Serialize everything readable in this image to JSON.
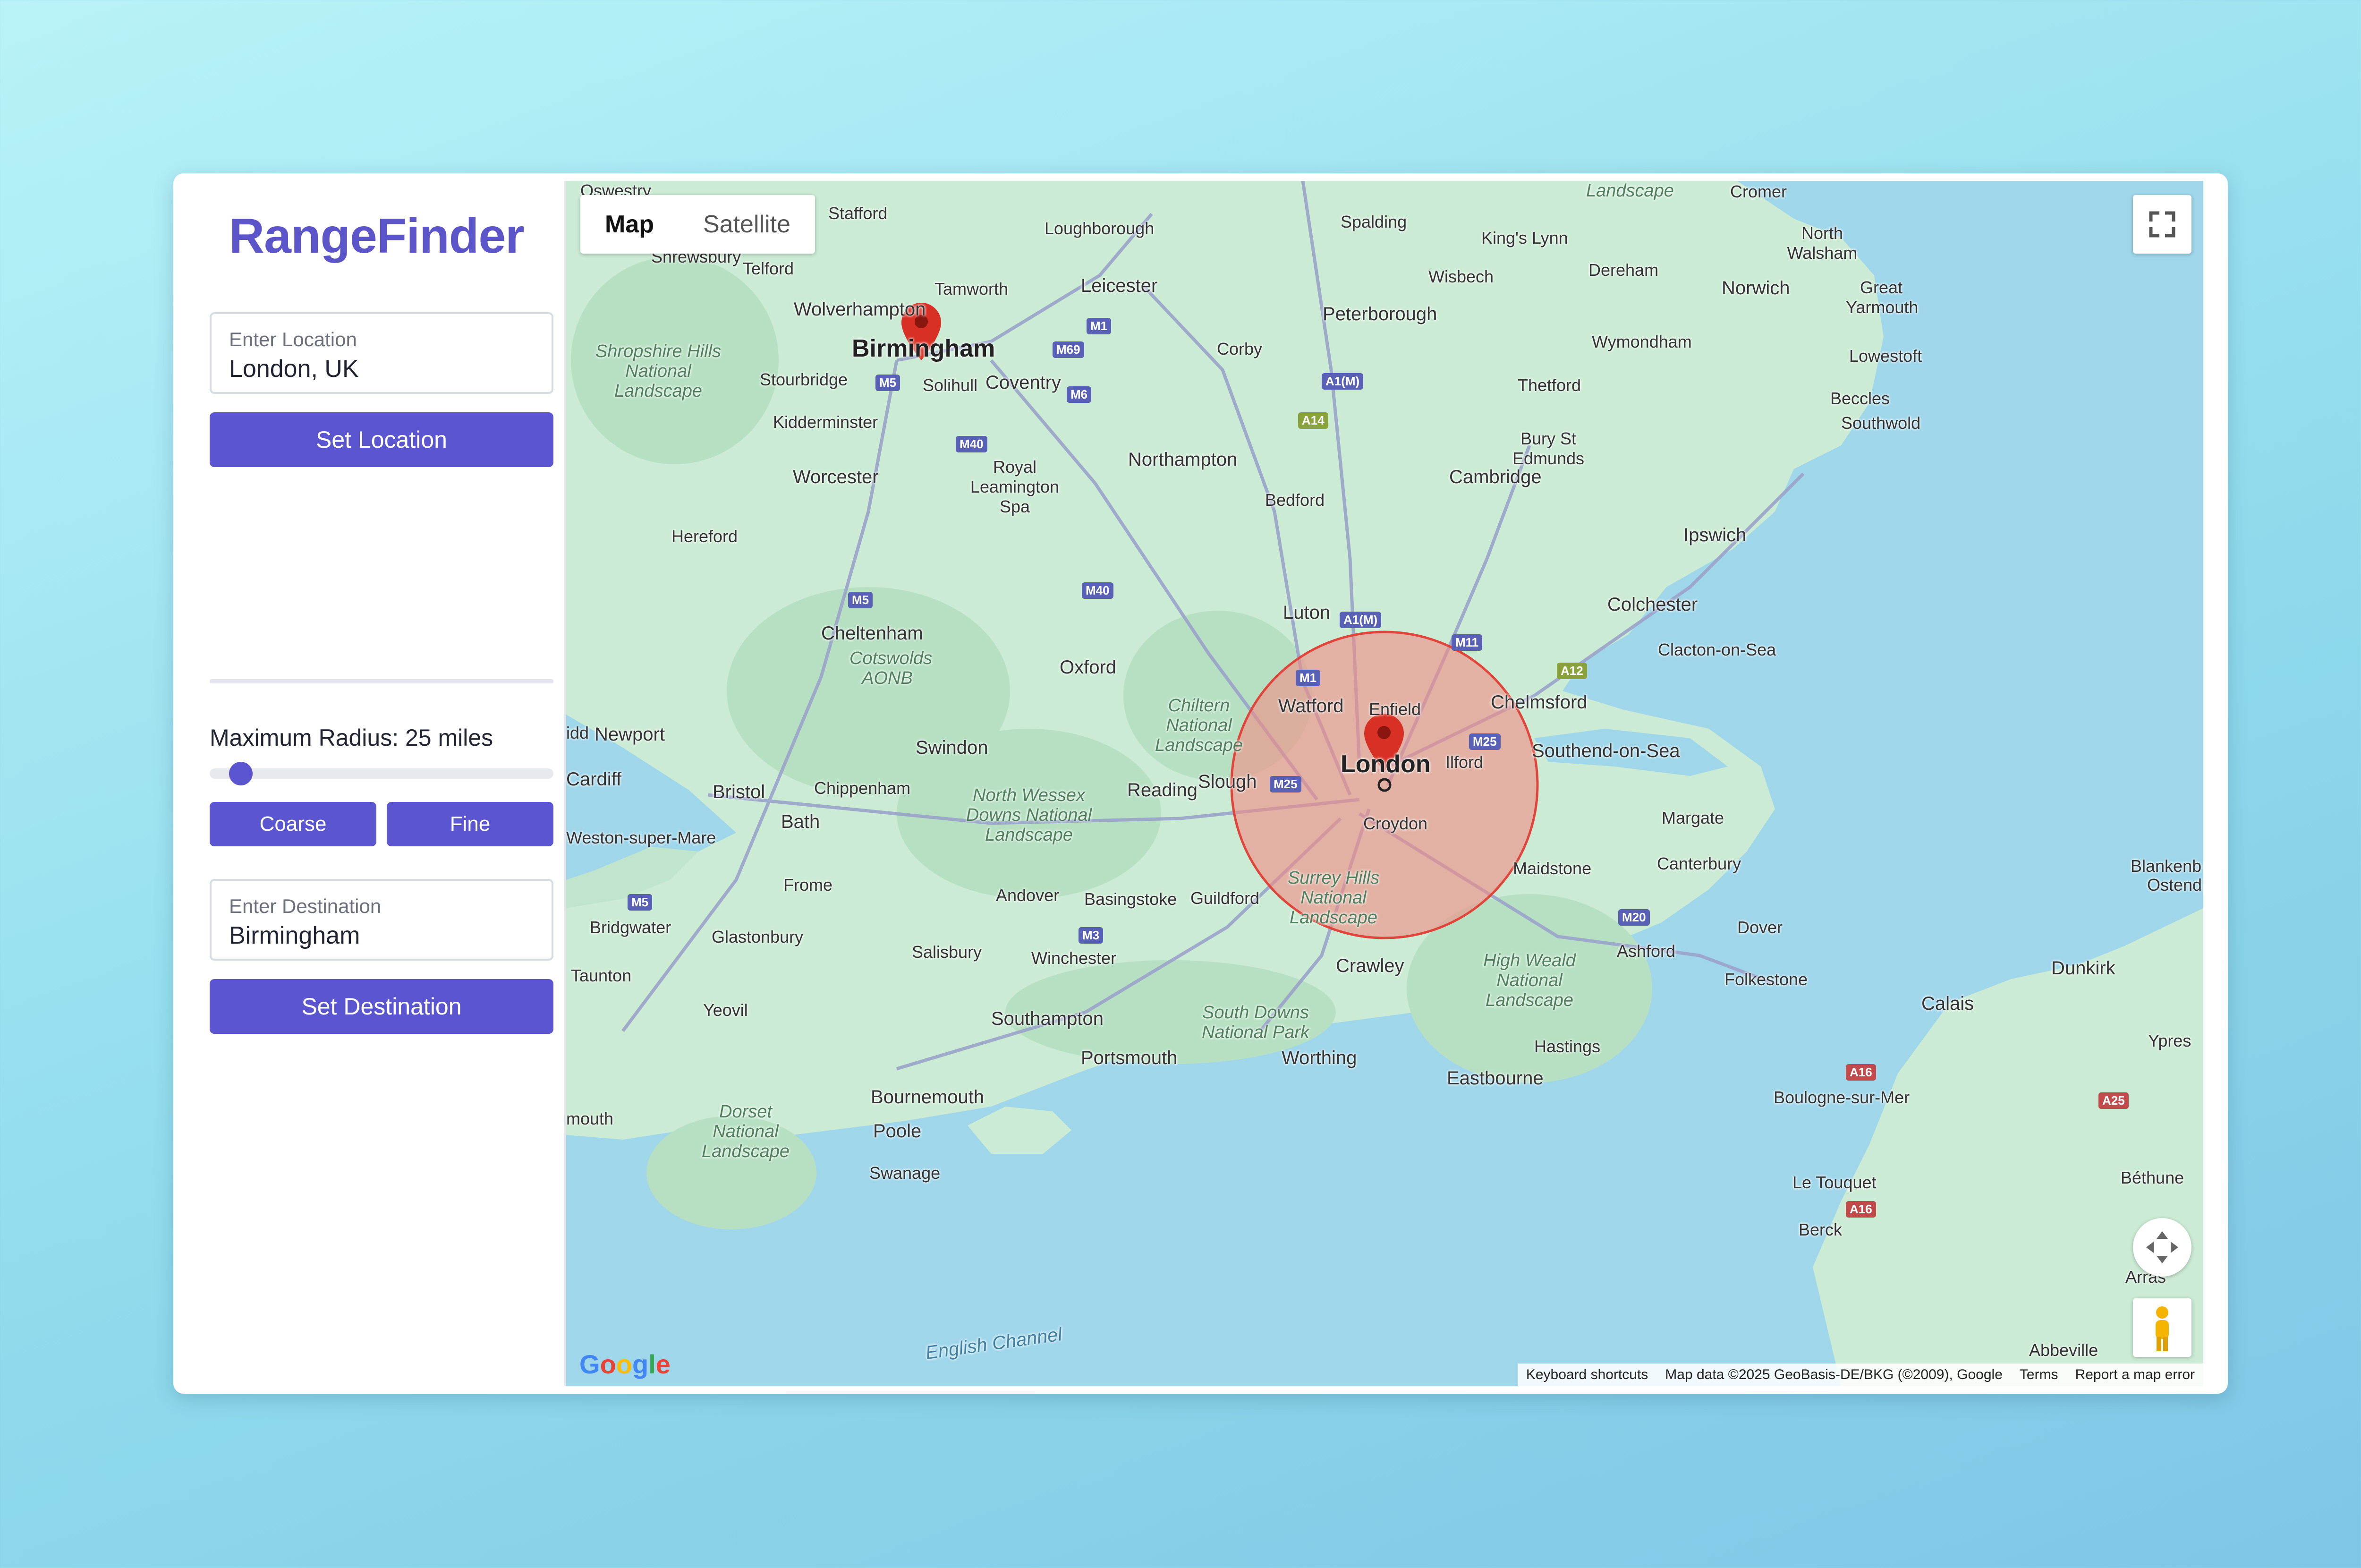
{
  "app": {
    "title": "RangeFinder"
  },
  "location": {
    "label": "Enter Location",
    "value": "London, UK",
    "button": "Set Location"
  },
  "radius": {
    "label": "Maximum Radius: 25 miles",
    "value_miles": 25,
    "slider_fraction": 0.09,
    "coarse_button": "Coarse",
    "fine_button": "Fine"
  },
  "destination": {
    "label": "Enter Destination",
    "value": "Birmingham",
    "button": "Set Destination"
  },
  "colors": {
    "accent": "#5b55d0",
    "radius_fill": "#f28b82",
    "radius_stroke": "#e0443a",
    "marker": "#d93025"
  },
  "map": {
    "tabs": {
      "map": "Map",
      "satellite": "Satellite"
    },
    "places": {
      "oswestry": "Oswestry",
      "stafford": "Stafford",
      "loughborough": "Loughborough",
      "spalding": "Spalding",
      "kings_lynn": "King's Lynn",
      "cromer": "Cromer",
      "north_walsham": "North Walsham",
      "landscape_top": "Landscape",
      "shrewsbury": "Shrewsbury",
      "telford": "Telford",
      "tamworth": "Tamworth",
      "leicester": "Leicester",
      "wisbech": "Wisbech",
      "dereham": "Dereham",
      "norwich": "Norwich",
      "great_yarmouth": "Great Yarmouth",
      "wolverhampton": "Wolverhampton",
      "peterborough": "Peterborough",
      "birmingham": "Birmingham",
      "solihull": "Solihull",
      "coventry": "Coventry",
      "corby": "Corby",
      "wymondham": "Wymondham",
      "lowestoft": "Lowestoft",
      "shropshire_hills": "Shropshire Hills National Landscape",
      "stourbridge": "Stourbridge",
      "thetford": "Thetford",
      "beccles": "Beccles",
      "kidderminster": "Kidderminster",
      "southwold": "Southwold",
      "royal_leamington": "Royal Leamington Spa",
      "northampton": "Northampton",
      "bury_st_edmunds": "Bury St Edmunds",
      "worcester": "Worcester",
      "cambridge": "Cambridge",
      "bedford": "Bedford",
      "hereford": "Hereford",
      "ipswich": "Ipswich",
      "luton": "Luton",
      "colchester": "Colchester",
      "cheltenham": "Cheltenham",
      "cotswolds": "Cotswolds AONB",
      "oxford": "Oxford",
      "clacton": "Clacton-on-Sea",
      "watford": "Watford",
      "enfield": "Enfield",
      "chelmsford": "Chelmsford",
      "chilterns": "Chiltern National Landscape",
      "newport": "Newport",
      "london": "London",
      "ilford": "Ilford",
      "southend": "Southend-on-Sea",
      "swindon": "Swindon",
      "cardiff": "Cardiff",
      "bristol": "Bristol",
      "chippenham": "Chippenham",
      "reading": "Reading",
      "slough": "Slough",
      "north_wessex": "North Wessex Downs National Landscape",
      "croydon": "Croydon",
      "margate": "Margate",
      "weston": "Weston-super-Mare",
      "bath": "Bath",
      "frome": "Frome",
      "andover": "Andover",
      "basingstoke": "Basingstoke",
      "guildford": "Guildford",
      "surrey_hills": "Surrey Hills National Landscape",
      "maidstone": "Maidstone",
      "canterbury": "Canterbury",
      "blankenberge": "Blankenb",
      "ostend": "Ostend",
      "bridgwater": "Bridgwater",
      "glastonbury": "Glastonbury",
      "salisbury": "Salisbury",
      "winchester": "Winchester",
      "crawley": "Crawley",
      "dover": "Dover",
      "ashford": "Ashford",
      "folkestone": "Folkestone",
      "dunkirk": "Dunkirk",
      "taunton": "Taunton",
      "high_weald": "High Weald National Landscape",
      "calais": "Calais",
      "yeovil": "Yeovil",
      "southampton": "Southampton",
      "south_downs": "South Downs National Park",
      "ypres": "Ypres",
      "hastings": "Hastings",
      "portsmouth": "Portsmouth",
      "worthing": "Worthing",
      "eastbourne": "Eastbourne",
      "bournemouth": "Bournemouth",
      "boulogne": "Boulogne-sur-Mer",
      "dorset": "Dorset National Landscape",
      "poole": "Poole",
      "exmouth": "mouth",
      "swanage": "Swanage",
      "le_touquet": "Le Touquet",
      "bethune": "Béthune",
      "berck": "Berck",
      "arras": "Arras",
      "abbeville": "Abbeville",
      "english_channel": "English Channel",
      "idd": "idd"
    },
    "roads": {
      "m1_a": "M1",
      "m69": "M69",
      "m6": "M6",
      "m5_a": "M5",
      "m40_a": "M40",
      "a1m_a": "A1(M)",
      "a14": "A14",
      "m5_b": "M5",
      "m40_b": "M40",
      "a1m_b": "A1(M)",
      "m11": "M11",
      "m1_b": "M1",
      "a12": "A12",
      "m25_a": "M25",
      "m25_b": "M25",
      "m5_c": "M5",
      "m3": "M3",
      "m20": "M20",
      "a16_a": "A16",
      "a25": "A25",
      "a16_b": "A16"
    },
    "attribution": {
      "google": "Google",
      "shortcuts": "Keyboard shortcuts",
      "data": "Map data ©2025 GeoBasis-DE/BKG (©2009), Google",
      "terms": "Terms",
      "report": "Report a map error"
    }
  }
}
